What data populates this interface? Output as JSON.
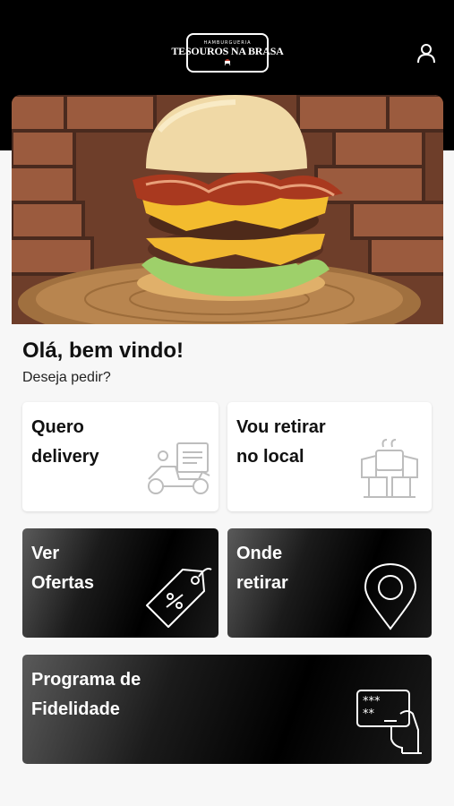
{
  "header": {
    "logo_top": "HAMBURGUERIA",
    "logo_name": "TESOUROS NA BRASA",
    "user_icon": "user-icon"
  },
  "hero": {
    "image": "burger-photo"
  },
  "welcome": {
    "title": "Olá, bem vindo!",
    "subtitle": "Deseja pedir?"
  },
  "cards": {
    "delivery": {
      "label": "Quero\ndelivery",
      "icon": "delivery-scooter-icon"
    },
    "pickup": {
      "label": "Vou retirar\nno local",
      "icon": "store-pickup-icon"
    },
    "offers": {
      "label": "Ver\nOfertas",
      "icon": "discount-tag-icon"
    },
    "where": {
      "label": "Onde\nretirar",
      "icon": "location-pin-icon"
    },
    "loyalty": {
      "label": "Programa de\nFidelidade",
      "icon": "loyalty-card-icon"
    }
  },
  "colors": {
    "header_bg": "#000000",
    "page_bg": "#f7f7f7",
    "card_light": "#ffffff",
    "card_dark": "#000000"
  }
}
